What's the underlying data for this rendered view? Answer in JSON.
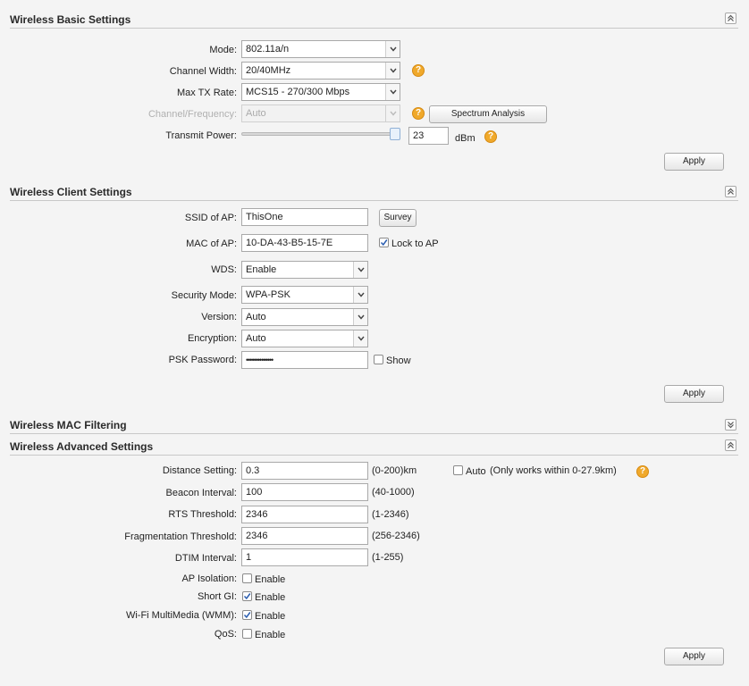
{
  "sections": {
    "basic": {
      "title": "Wireless Basic Settings"
    },
    "client": {
      "title": "Wireless Client Settings"
    },
    "mac": {
      "title": "Wireless MAC Filtering"
    },
    "advanced": {
      "title": "Wireless Advanced Settings"
    }
  },
  "basic": {
    "mode_label": "Mode:",
    "mode_value": "802.11a/n",
    "channel_width_label": "Channel Width:",
    "channel_width_value": "20/40MHz",
    "max_tx_label": "Max TX Rate:",
    "max_tx_value": "MCS15 - 270/300 Mbps",
    "channel_freq_label": "Channel/Frequency:",
    "channel_freq_value": "Auto",
    "spectrum_button": "Spectrum Analysis",
    "transmit_power_label": "Transmit Power:",
    "transmit_power_value": "23",
    "transmit_power_unit": "dBm",
    "transmit_power_level": 1.0,
    "apply": "Apply"
  },
  "client": {
    "ssid_label": "SSID of AP:",
    "ssid_value": "ThisOne",
    "survey_button": "Survey",
    "mac_label": "MAC of AP:",
    "mac_value": "10-DA-43-B5-15-7E",
    "lock_label": "Lock to AP",
    "lock_checked": true,
    "wds_label": "WDS:",
    "wds_value": "Enable",
    "security_label": "Security Mode:",
    "security_value": "WPA-PSK",
    "version_label": "Version:",
    "version_value": "Auto",
    "encryption_label": "Encryption:",
    "encryption_value": "Auto",
    "psk_label": "PSK Password:",
    "psk_value": "••••••••••••••",
    "show_label": "Show",
    "show_checked": false,
    "apply": "Apply"
  },
  "advanced": {
    "distance_label": "Distance Setting:",
    "distance_value": "0.3",
    "distance_range": "(0-200)km",
    "auto_label": "Auto",
    "auto_note": "(Only works within 0-27.9km)",
    "auto_checked": false,
    "beacon_label": "Beacon Interval:",
    "beacon_value": "100",
    "beacon_range": "(40-1000)",
    "rts_label": "RTS Threshold:",
    "rts_value": "2346",
    "rts_range": "(1-2346)",
    "frag_label": "Fragmentation Threshold:",
    "frag_value": "2346",
    "frag_range": "(256-2346)",
    "dtim_label": "DTIM Interval:",
    "dtim_value": "1",
    "dtim_range": "(1-255)",
    "ap_isolation_label": "AP Isolation:",
    "short_gi_label": "Short GI:",
    "wmm_label": "Wi-Fi MultiMedia (WMM):",
    "qos_label": "QoS:",
    "enable_text": "Enable",
    "ap_isolation_checked": false,
    "short_gi_checked": true,
    "wmm_checked": true,
    "qos_checked": false,
    "apply": "Apply"
  },
  "icons": {
    "help": "help-icon",
    "collapse": "collapse-up-icon",
    "expand": "expand-down-icon",
    "dropdown": "chevron-down-icon",
    "check": "checkmark-icon"
  },
  "colors": {
    "help_icon": "#f0a92b",
    "check": "#2a5db0"
  }
}
